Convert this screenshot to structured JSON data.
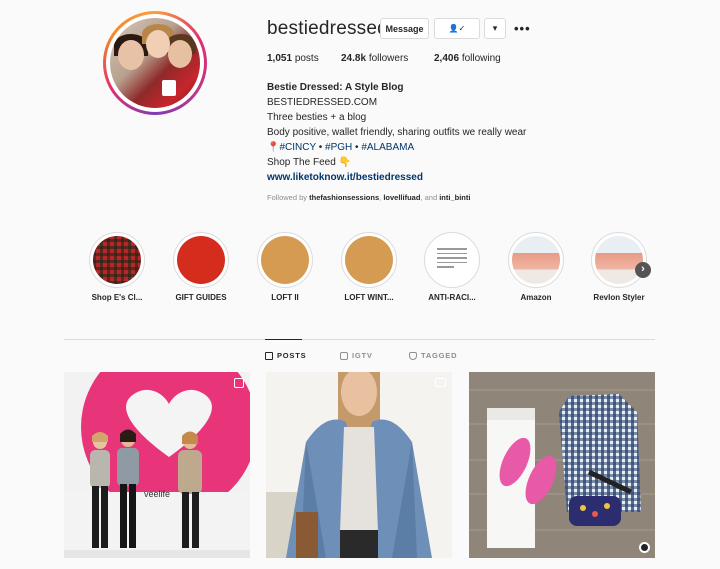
{
  "profile": {
    "username": "bestiedressed",
    "message_label": "Message",
    "follow_icon_label": "👤✓",
    "dropdown_icon": "▾",
    "more_icon": "•••"
  },
  "stats": {
    "posts_count": "1,051",
    "posts_label": "posts",
    "followers_count": "24.8k",
    "followers_label": "followers",
    "following_count": "2,406",
    "following_label": "following"
  },
  "bio": {
    "name": "Bestie Dressed: A Style Blog",
    "line1": "BESTIEDRESSED.COM",
    "line2": "Three besties + a blog",
    "line3": "Body positive, wallet friendly, sharing outfits we really wear",
    "pin_emoji": "📍",
    "tag1": "#CINCY",
    "sep": " • ",
    "tag2": "#PGH",
    "tag3": "#ALABAMA",
    "line5": "Shop The Feed",
    "point_emoji": "👇",
    "link": "www.liketoknow.it/bestiedressed"
  },
  "followed_by": {
    "prefix": "Followed by",
    "user1": "thefashionsessions",
    "comma": ",",
    "user2": "lovellifuad",
    "and": ", and",
    "user3": "inti_binti"
  },
  "highlights": [
    {
      "label": "Shop E's Cl..."
    },
    {
      "label": "GIFT GUIDES"
    },
    {
      "label": "LOFT II"
    },
    {
      "label": "LOFT WINT..."
    },
    {
      "label": "ANTI-RACI..."
    },
    {
      "label": "Amazon"
    },
    {
      "label": "Revlon Styler"
    }
  ],
  "highlights_next_icon": "›",
  "tabs": [
    {
      "label": "POSTS",
      "icon": "grid-icon"
    },
    {
      "label": "IGTV",
      "icon": "tv-icon"
    },
    {
      "label": "TAGGED",
      "icon": "tag-icon"
    }
  ],
  "colors": {
    "link": "#00376b",
    "text": "#262626",
    "muted": "#8e8e8e",
    "border": "#dbdbdb"
  },
  "posts": [
    {
      "overlay_text": "veelife"
    },
    {
      "overlay_text": ""
    },
    {
      "overlay_text": ""
    }
  ]
}
